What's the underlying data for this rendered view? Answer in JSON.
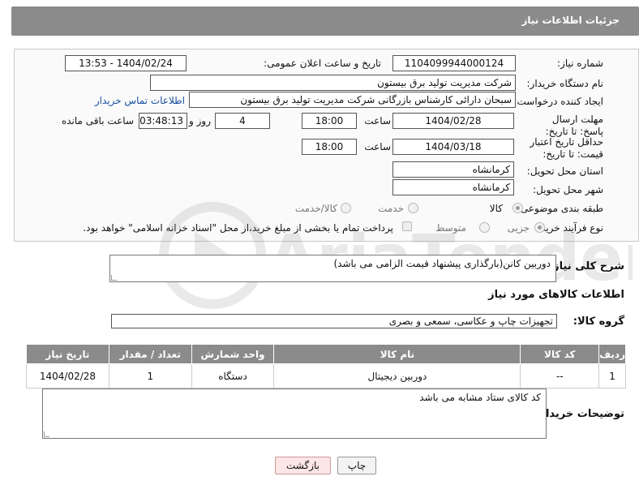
{
  "header": {
    "title": "جزئیات اطلاعات نیاز"
  },
  "fields": {
    "need_number_label": "شماره نیاز:",
    "need_number": "1104099944000124",
    "announce_label": "تاریخ و ساعت اعلان عمومی:",
    "announce_value": "1404/02/24 - 13:53",
    "buyer_org_label": "نام دستگاه خریدار:",
    "buyer_org": "شرکت مدیریت تولید برق بیستون",
    "creator_label": "ایجاد کننده درخواست:",
    "creator": "سبحان دارائی کارشناس بازرگانی شرکت مدیریت تولید برق بیستون",
    "contact_link": "اطلاعات تماس خریدار",
    "deadline_label": "مهلت ارسال پاسخ: تا تاریخ:",
    "deadline_date": "1404/02/28",
    "time_label": "ساعت",
    "deadline_time": "18:00",
    "days_value": "4",
    "days_label": "روز و",
    "remaining_time": "03:48:13",
    "remaining_label": "ساعت باقی مانده",
    "validity_label": "حداقل تاریخ اعتبار قیمت: تا تاریخ:",
    "validity_date": "1404/03/18",
    "validity_time": "18:00",
    "province_label": "استان محل تحویل:",
    "province": "کرمانشاه",
    "city_label": "شهر محل تحویل:",
    "city": "کرمانشاه",
    "category_label": "طبقه بندی موضوعی:",
    "category_options": [
      "کالا",
      "خدمت",
      "کالا/خدمت"
    ],
    "process_label": "نوع فرآیند خرید :",
    "process_options": [
      "جزیی",
      "متوسط"
    ],
    "payment_note": "پرداخت تمام یا بخشی از مبلغ خرید،از محل \"اسناد خزانه اسلامی\" خواهد بود."
  },
  "description": {
    "label": "شرح کلی نیاز:",
    "value": "دوربین کانن(بارگذاری پیشنهاد قیمت الزامی می باشد)"
  },
  "goods_section": {
    "title": "اطلاعات کالاهای مورد نیاز",
    "group_label": "گروه کالا:",
    "group_value": "تجهیزات چاپ و عکاسی، سمعی و بصری"
  },
  "table": {
    "headers": [
      "ردیف",
      "کد کالا",
      "نام کالا",
      "واحد شمارش",
      "تعداد / مقدار",
      "تاریخ نیاز"
    ],
    "rows": [
      [
        "1",
        "--",
        "دوربین دیجیتال",
        "دستگاه",
        "1",
        "1404/02/28"
      ]
    ]
  },
  "buyer_notes": {
    "label": "توضیحات خریدار:",
    "value": "کد کالای ستاد مشابه می باشد"
  },
  "buttons": {
    "print": "چاپ",
    "back": "بازگشت"
  },
  "watermark": {
    "text": "AriaTender.neT"
  }
}
